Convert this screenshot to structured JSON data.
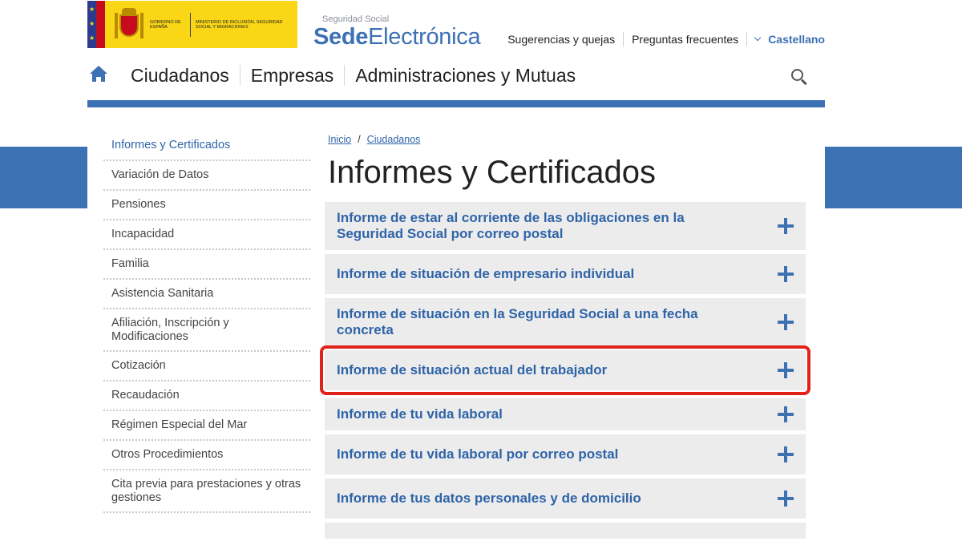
{
  "header": {
    "gov_logo": {
      "gov_text": "Gobierno de España",
      "ministry_text": "Ministerio de Inclusión, Seguridad Social y Migraciones"
    },
    "brand": {
      "subtitle": "Seguridad Social",
      "name_bold": "Sede",
      "name_regular": "Electrónica"
    },
    "top_links": {
      "suggestions": "Sugerencias y quejas",
      "faq": "Preguntas frecuentes",
      "language": "Castellano"
    }
  },
  "nav": {
    "items": [
      "Ciudadanos",
      "Empresas",
      "Administraciones y Mutuas"
    ]
  },
  "sidebar": {
    "items": [
      {
        "label": "Informes y Certificados",
        "active": true
      },
      {
        "label": "Variación de Datos"
      },
      {
        "label": "Pensiones"
      },
      {
        "label": "Incapacidad"
      },
      {
        "label": "Familia"
      },
      {
        "label": "Asistencia Sanitaria"
      },
      {
        "label": "Afiliación, Inscripción y Modificaciones"
      },
      {
        "label": "Cotización"
      },
      {
        "label": "Recaudación"
      },
      {
        "label": "Régimen Especial del Mar"
      },
      {
        "label": "Otros Procedimientos"
      },
      {
        "label": "Cita previa para prestaciones y otras gestiones"
      }
    ]
  },
  "breadcrumb": {
    "home": "Inicio",
    "separator": "/",
    "current": "Ciudadanos"
  },
  "main": {
    "title": "Informes y Certificados",
    "accordion": [
      {
        "label": "Informe de estar al corriente de las obligaciones en la Seguridad Social por correo postal"
      },
      {
        "label": "Informe de situación de empresario individual"
      },
      {
        "label": "Informe de situación en la Seguridad Social a una fecha concreta"
      },
      {
        "label": "Informe de situación actual del trabajador",
        "highlighted": true
      },
      {
        "label": "Informe de tu vida laboral"
      },
      {
        "label": "Informe de tu vida laboral por correo postal"
      },
      {
        "label": "Informe de tus datos personales y de domicilio"
      },
      {
        "label": ""
      }
    ]
  },
  "colors": {
    "brand_blue": "#3c71b4",
    "link_blue": "#2f64a8",
    "highlight_red": "#e2231a",
    "gov_yellow": "#f9d616"
  }
}
